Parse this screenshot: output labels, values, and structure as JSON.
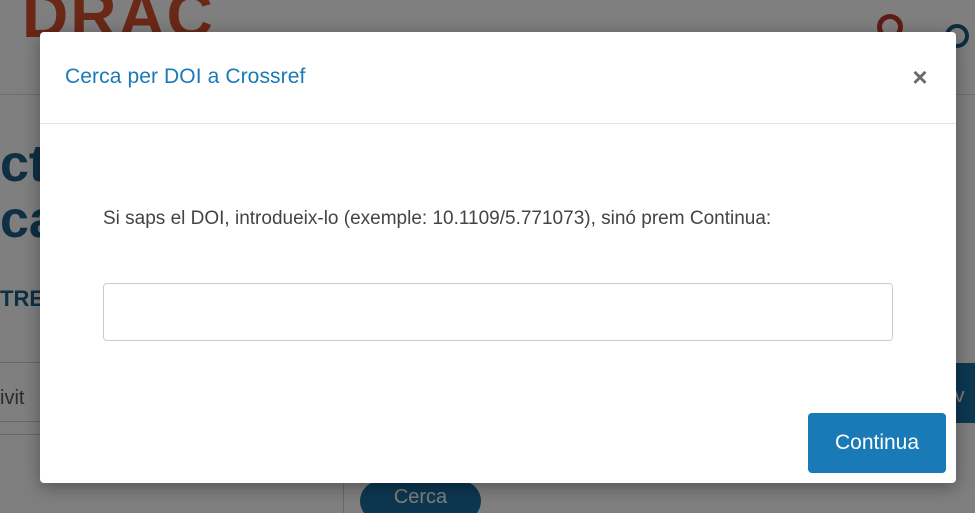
{
  "background": {
    "logo_text": "DRAC",
    "title_fragment": "ct\nca",
    "section_fragment": "TRE",
    "field_fragment": "ivit",
    "tab_fragment": "iv",
    "search_button": "Cerca"
  },
  "modal": {
    "title": "Cerca per DOI a Crossref",
    "close_symbol": "×",
    "instructions": "Si saps el DOI, introdueix-lo (exemple: 10.1109/5.771073), sinó prem Continua:",
    "doi_input_value": "",
    "continue_label": "Continua"
  },
  "colors": {
    "accent": "#1a7ab8",
    "logo": "#d4502c",
    "overlay": "rgba(0,0,0,0.5)"
  }
}
